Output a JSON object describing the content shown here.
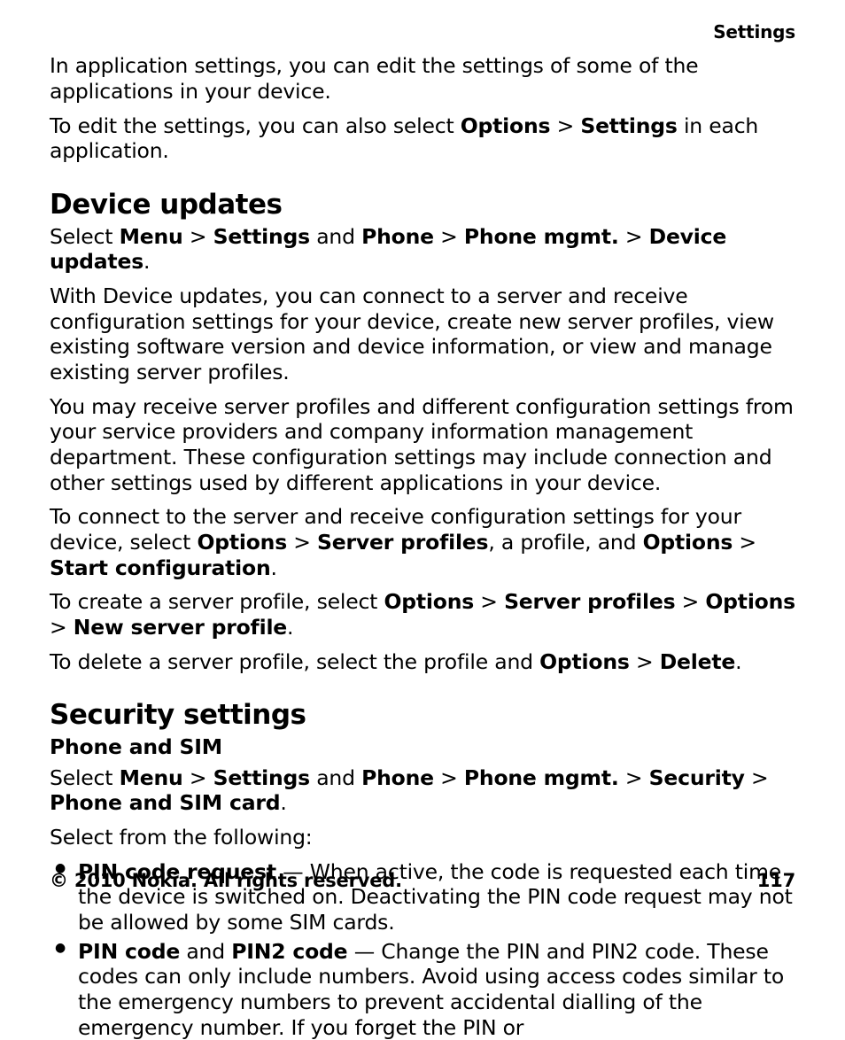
{
  "runningHead": "Settings",
  "intro": {
    "p1": "In application settings, you can edit the settings of some of the applications in your device.",
    "p2_pre": "To edit the settings, you can also select ",
    "p2_b1": "Options",
    "p2_s1": " > ",
    "p2_b2": "Settings",
    "p2_post": " in each application."
  },
  "deviceUpdates": {
    "title": "Device updates",
    "p1_pre": "Select ",
    "p1_b1": "Menu",
    "p1_s1": " > ",
    "p1_b2": "Settings",
    "p1_mid1": " and ",
    "p1_b3": "Phone",
    "p1_s2": " > ",
    "p1_b4": "Phone mgmt.",
    "p1_s3": " > ",
    "p1_b5": "Device updates",
    "p1_post": ".",
    "p2": "With Device updates, you can connect to a server and receive configuration settings for your device, create new server profiles, view existing software version and device information, or view and manage existing server profiles.",
    "p3": "You may receive server profiles and different configuration settings from your service providers and company information management department. These configuration settings may include connection and other settings used by different applications in your device.",
    "p4_pre": "To connect to the server and receive configuration settings for your device, select ",
    "p4_b1": "Options",
    "p4_s1": " > ",
    "p4_b2": "Server profiles",
    "p4_mid": ", a profile, and ",
    "p4_b3": "Options",
    "p4_s2": " > ",
    "p4_b4": "Start configuration",
    "p4_post": ".",
    "p5_pre": "To create a server profile, select ",
    "p5_b1": "Options",
    "p5_s1": " > ",
    "p5_b2": "Server profiles",
    "p5_s2": " > ",
    "p5_b3": "Options",
    "p5_s3": " > ",
    "p5_b4": "New server profile",
    "p5_post": ".",
    "p6_pre": "To delete a server profile, select the profile and ",
    "p6_b1": "Options",
    "p6_s1": " > ",
    "p6_b2": "Delete",
    "p6_post": "."
  },
  "security": {
    "title": "Security settings",
    "sub1": "Phone and SIM",
    "p1_pre": "Select ",
    "p1_b1": "Menu",
    "p1_s1": " > ",
    "p1_b2": "Settings",
    "p1_mid1": " and ",
    "p1_b3": "Phone",
    "p1_s2": " > ",
    "p1_b4": "Phone mgmt.",
    "p1_s3": " > ",
    "p1_b5": "Security",
    "p1_s4": " > ",
    "p1_b6": "Phone and SIM card",
    "p1_post": ".",
    "p2": "Select from the following:",
    "li1_b": "PIN code request",
    "li1_rest": "  — When active, the code is requested each time the device is switched on. Deactivating the PIN code request may not be allowed by some SIM cards.",
    "li2_b1": "PIN code",
    "li2_mid": " and ",
    "li2_b2": "PIN2 code",
    "li2_rest": " — Change the PIN and PIN2 code. These codes can only include numbers. Avoid using access codes similar to the emergency numbers to prevent accidental dialling of the emergency number. If you forget the PIN or"
  },
  "footer": {
    "copyright": "© 2010 Nokia. All rights reserved.",
    "pageNumber": "117"
  }
}
